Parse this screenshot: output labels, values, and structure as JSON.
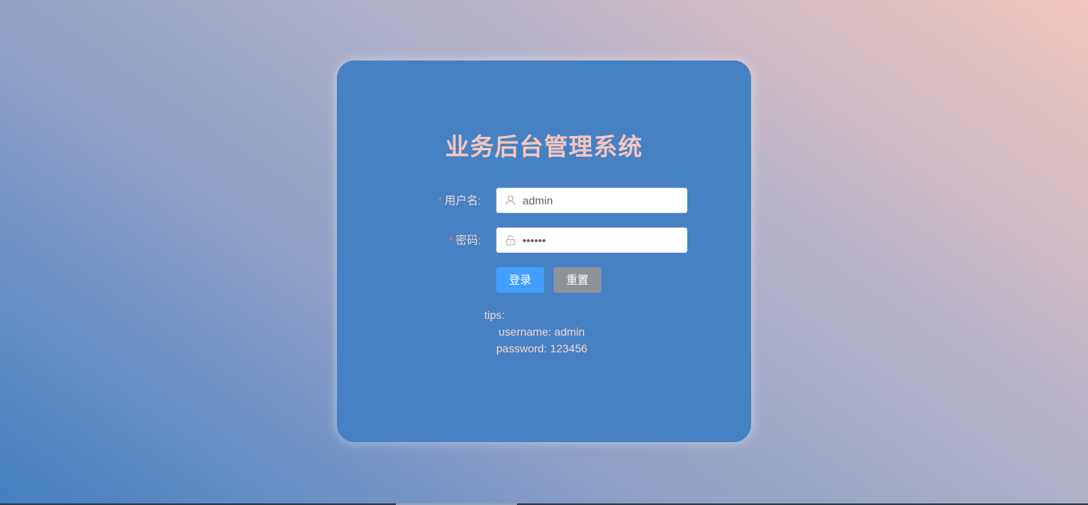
{
  "login": {
    "title": "业务后台管理系统",
    "username_label": "用户名:",
    "username_value": "admin",
    "password_label": "密码:",
    "password_value": "••••••",
    "required_mark": "*",
    "login_button": "登录",
    "reset_button": "重置"
  },
  "tips": {
    "head": "tips:",
    "username": "username: admin",
    "password": "password: 123456"
  },
  "colors": {
    "card": "#4681c4",
    "title": "#f6c6bd",
    "primary": "#409eff",
    "reset": "#8f9398"
  }
}
